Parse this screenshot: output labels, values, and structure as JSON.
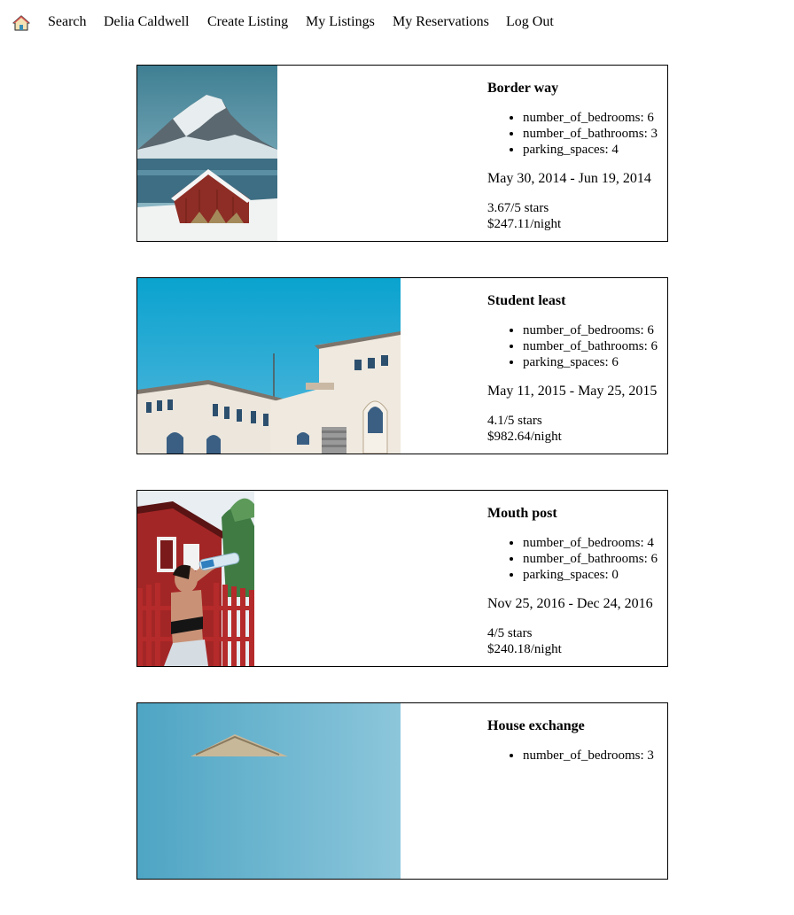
{
  "nav": {
    "home_icon": "house-icon",
    "search": "Search",
    "user": "Delia Caldwell",
    "create": "Create Listing",
    "my_listings": "My Listings",
    "my_reservations": "My Reservations",
    "logout": "Log Out"
  },
  "listings": [
    {
      "title": "Border way",
      "amenities": [
        "number_of_bedrooms: 6",
        "number_of_bathrooms: 3",
        "parking_spaces: 4"
      ],
      "dates": "May 30, 2014 - Jun 19, 2014",
      "rating": "3.67/5 stars",
      "price": "$247.11/night",
      "image": "snowy-mountain-red-cabin"
    },
    {
      "title": "Student least",
      "amenities": [
        "number_of_bedrooms: 6",
        "number_of_bathrooms: 6",
        "parking_spaces: 6"
      ],
      "dates": "May 11, 2015 - May 25, 2015",
      "rating": "4.1/5 stars",
      "price": "$982.64/night",
      "image": "white-building-blue-sky"
    },
    {
      "title": "Mouth post",
      "amenities": [
        "number_of_bedrooms: 4",
        "number_of_bathrooms: 6",
        "parking_spaces: 0"
      ],
      "dates": "Nov 25, 2016 - Dec 24, 2016",
      "rating": "4/5 stars",
      "price": "$240.18/night",
      "image": "woman-drinking-red-house"
    },
    {
      "title": "House exchange",
      "amenities": [
        "number_of_bedrooms: 3"
      ],
      "dates": "",
      "rating": "",
      "price": "",
      "image": "house-roof-blue-sky"
    }
  ]
}
